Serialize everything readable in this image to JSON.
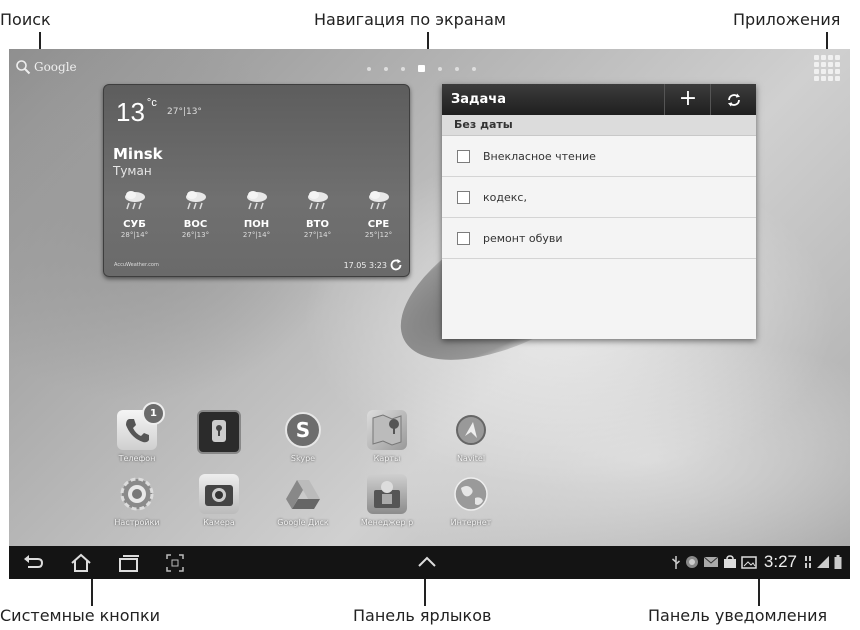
{
  "callouts": {
    "search": "Поиск",
    "navigation": "Навигация по экранам",
    "apps": "Приложения",
    "system_buttons": "Системные кнопки",
    "shortcuts_panel": "Панель ярлыков",
    "notifications_panel": "Панель уведомления"
  },
  "topbar": {
    "google_text": "Google",
    "screen_dots": 7,
    "active_screen": 3
  },
  "weather": {
    "temp": "13",
    "unit": "°c",
    "range": "27°|13°",
    "city": "Minsk",
    "condition": "Туман",
    "forecast": [
      {
        "day": "СУБ",
        "temp": "28°|14°"
      },
      {
        "day": "ВОС",
        "temp": "26°|13°"
      },
      {
        "day": "ПОН",
        "temp": "27°|14°"
      },
      {
        "day": "ВТО",
        "temp": "27°|14°"
      },
      {
        "day": "СРЕ",
        "temp": "25°|12°"
      }
    ],
    "source": "AccuWeather.com",
    "updated": "17.05 3:23"
  },
  "task_widget": {
    "title": "Задача",
    "add_label": "+",
    "section": "Без даты",
    "items": [
      "Внекласное чтение",
      "кодекс,",
      "ремонт обуви"
    ]
  },
  "apps": {
    "row1": [
      "Телефон",
      "",
      "Skype",
      "Карты",
      "Navitel"
    ],
    "row2": [
      "Настройки",
      "Камера",
      "Google Диск",
      "Менеджер р",
      "Интернет"
    ],
    "phone_badge": "1"
  },
  "statusbar": {
    "time": "3:27"
  },
  "colors": {
    "navbar": "#141414",
    "widget_header": "#2a2a2a"
  }
}
